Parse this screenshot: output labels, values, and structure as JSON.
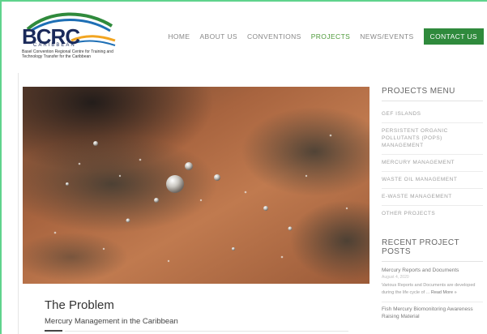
{
  "logo": {
    "acronym": "BCRC",
    "region": "CARIBBEAN",
    "tagline": "Basel Convention Regional Centre for Training and Technology Transfer for the Caribbean"
  },
  "nav": {
    "items": [
      {
        "label": "HOME",
        "active": false
      },
      {
        "label": "ABOUT US",
        "active": false
      },
      {
        "label": "CONVENTIONS",
        "active": false
      },
      {
        "label": "PROJECTS",
        "active": true
      },
      {
        "label": "NEWS/EVENTS",
        "active": false
      }
    ],
    "contact_label": "CONTACT US"
  },
  "main": {
    "title": "The Problem",
    "subtitle": "Mercury Management in the Caribbean"
  },
  "sidebar": {
    "projects_heading": "PROJECTS MENU",
    "menu": [
      "GEF ISLANDS",
      "PERSISTENT ORGANIC POLLUTANTS (POPS) MANAGEMENT",
      "MERCURY MANAGEMENT",
      "WASTE OIL MANAGEMENT",
      "E-WASTE MANAGEMENT",
      "OTHER PROJECTS"
    ],
    "posts_heading": "RECENT PROJECT POSTS",
    "posts": [
      {
        "title": "Mercury Reports and Documents",
        "date": "August 4, 2020",
        "excerpt": "Various Reports and Documents are developed during the life cycle of ...",
        "read_more": "Read More »"
      },
      {
        "title": "Fish Mercury Biomonitoring Awareness Raising Material"
      }
    ]
  },
  "colors": {
    "brand_green": "#2f8a3c",
    "active_nav": "#4e9a3a",
    "logo_navy": "#1b2a5a"
  }
}
